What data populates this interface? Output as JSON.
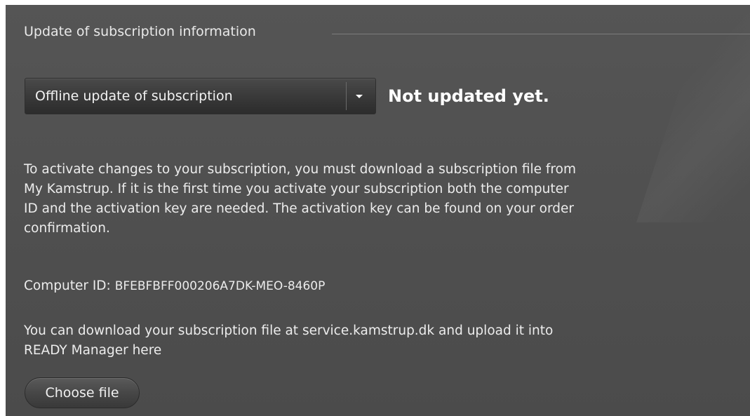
{
  "section": {
    "legend": "Update of subscription information"
  },
  "update_mode": {
    "selected": "Offline update of subscription",
    "icon": "chevron-down-icon"
  },
  "status_text": "Not updated yet.",
  "instructions": {
    "lines": [
      "To activate changes to your subscription, you must download a subscription file from",
      "My Kamstrup. If it is the first time you activate your subscription both the computer",
      "ID and the activation key are needed. The activation key can be found on your order",
      "confirmation."
    ]
  },
  "computer_id": {
    "label": "Computer ID:",
    "value": "BFEBFBFF000206A7DK-MEO-8460P"
  },
  "download_info": {
    "lines": [
      "You can download your subscription file at service.kamstrup.dk and upload it into",
      "READY Manager here"
    ]
  },
  "choose_file_button": {
    "label": "Choose file"
  },
  "colors": {
    "panel_background": "#535353",
    "text": "#ececec",
    "status_text": "#ffffff"
  }
}
